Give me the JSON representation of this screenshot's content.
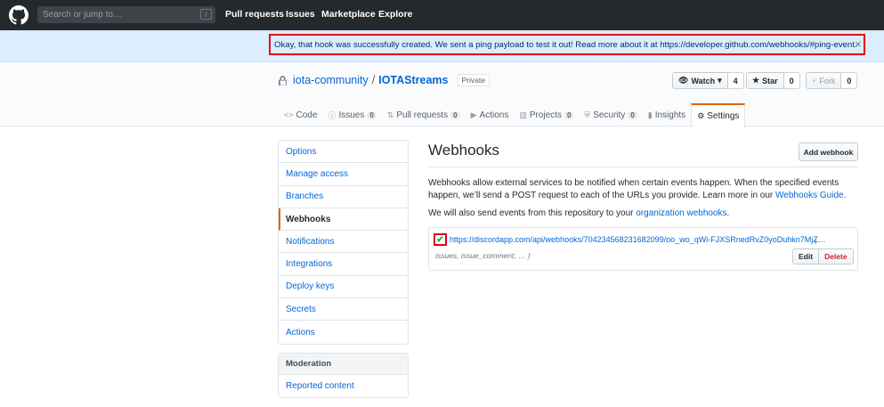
{
  "header": {
    "search_placeholder": "Search or jump to…",
    "search_shortcut": "/",
    "nav": [
      "Pull requests",
      "Issues",
      "Marketplace",
      "Explore"
    ]
  },
  "flash": {
    "message": "Okay, that hook was successfully created. We sent a ping payload to test it out! Read more about it at https://developer.github.com/webhooks/#ping-event.",
    "close": "×"
  },
  "repo": {
    "owner": "iota-community",
    "separator": "/",
    "name": "IOTAStreams",
    "visibility": "Private",
    "watch_label": "Watch",
    "watch_count": "4",
    "star_label": "Star",
    "star_count": "0",
    "fork_label": "Fork",
    "fork_count": "0"
  },
  "tabs": [
    {
      "label": "Code",
      "icon": "<>",
      "count": ""
    },
    {
      "label": "Issues",
      "icon": "ⓘ",
      "count": "0"
    },
    {
      "label": "Pull requests",
      "icon": "⇅",
      "count": "0"
    },
    {
      "label": "Actions",
      "icon": "▶",
      "count": ""
    },
    {
      "label": "Projects",
      "icon": "▥",
      "count": "0"
    },
    {
      "label": "Security",
      "icon": "⛨",
      "count": "0"
    },
    {
      "label": "Insights",
      "icon": "▮",
      "count": ""
    },
    {
      "label": "Settings",
      "icon": "⚙",
      "count": ""
    }
  ],
  "menu": [
    "Options",
    "Manage access",
    "Branches",
    "Webhooks",
    "Notifications",
    "Integrations",
    "Deploy keys",
    "Secrets",
    "Actions"
  ],
  "moderation": {
    "heading": "Moderation",
    "items": [
      "Reported content"
    ]
  },
  "main": {
    "title": "Webhooks",
    "add_button": "Add webhook",
    "desc_before": "Webhooks allow external services to be notified when certain events happen. When the specified events happen, we’ll send a POST request to each of the URLs you provide. Learn more in our ",
    "desc_link": "Webhooks Guide",
    "desc_after": ".",
    "org_before": "We will also send events from this repository to your ",
    "org_link": "organization webhooks",
    "org_after": "."
  },
  "hook": {
    "status": "✔",
    "url": "https://discordapp.com/api/webhooks/704234568231682099/oo_wo_qWi-FJXSRnedRvZ0yoDuhkn7MjZ…",
    "paren": "(",
    "events": "issues, issue_comment, … )",
    "edit": "Edit",
    "delete": "Delete"
  },
  "colors": {
    "header_bg": "#24292e",
    "flash_bg": "#dbedff",
    "link": "#0366d6",
    "highlight_border": "#e2001a",
    "selected_tab_accent": "#e36209"
  }
}
